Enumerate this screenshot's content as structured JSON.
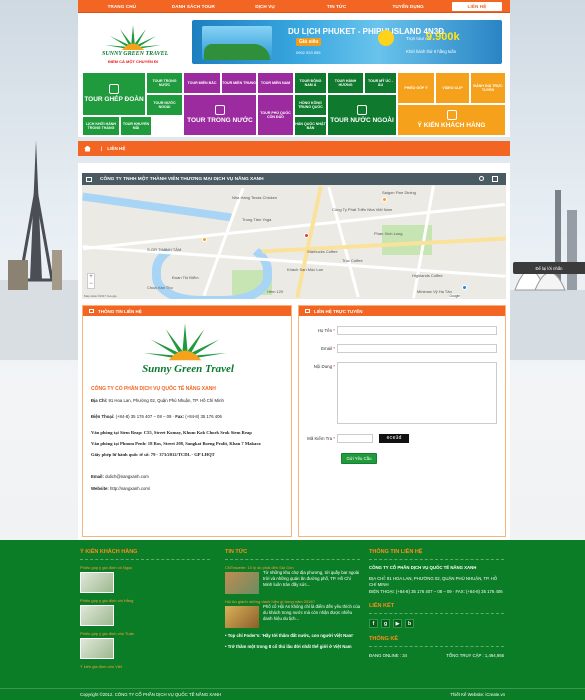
{
  "nav": {
    "items": [
      "TRANG CHỦ",
      "DANH SÁCH TOUR",
      "DỊCH VỤ",
      "TIN TỨC",
      "TUYỂN DỤNG",
      "LIÊN HỆ"
    ]
  },
  "logo": {
    "brand": "SUNNY GREEN TRAVEL",
    "slogan": "ĐIỂM CÀ MỘT CHUYẾN ĐI"
  },
  "banner": {
    "title": "DU LỊCH PHUKET - PHIPHI ISLAND 4N3Đ",
    "badge": "Giá siêu",
    "from": "Trọn tour chỉ",
    "price": "9.900k",
    "sub": "Khởi hành thứ 6 hằng tuần",
    "phone": "0902 533 599"
  },
  "mega": {
    "tour_ghep_doan": "TOUR GHÉP ĐOÀN",
    "tour_trong_nuoc_s": "TOUR TRONG NƯỚC",
    "tour_mien_bac": "TOUR MIỀN BẮC",
    "tour_mien_trung": "TOUR MIỀN TRUNG",
    "tour_mien_nam": "TOUR MIỀN NAM",
    "tour_dong_nam_a": "TOUR ĐÔNG NAM Á",
    "tour_hanh_huong": "TOUR HÀNH HƯƠNG",
    "tour_my_uc_au": "TOUR MỸ ÚC - ÂU",
    "phieu_gop_y": "PHIẾU GÓP Ý",
    "video_clip": "VIDEO CLIP",
    "danh_gia": "ĐÁNH GIÁ TRỰC TUYẾN",
    "lich_khoi_hanh": "LỊCH KHỞI HÀNH TRONG THÁNG",
    "tour_nuoc_ngoai_s": "TOUR NƯỚC NGOÀI",
    "tour_trong_nuoc_b": "TOUR TRONG NƯỚC",
    "phu_quoc": "TOUR PHÚ QUỐC CÔN ĐẢO",
    "tour_nuoc_ngoai_b": "TOUR NƯỚC NGOÀI",
    "hong_kong": "HỒNG KÔNG TRUNG QUỐC",
    "han_quoc": "HÀN QUỐC NHẬT BẢN",
    "tour_khuyen_mai": "TOUR KHUYẾN MÃI",
    "y_kien": "Ý KIẾN KHÁCH HÀNG"
  },
  "breadcrumb": {
    "current": "LIÊN HỆ"
  },
  "map": {
    "title": "CÔNG TY TNHH MỘT THÀNH VIÊN THƯƠNG MẠI DỊCH VỤ NẮNG XANH",
    "labels": [
      "Nha Hàng Texas Chicken",
      "Công Ty Phát Triển Nhà Việt Nam",
      "Starbucks Coffee",
      "Phan Xích Long",
      "Khách Sạn Mộc Lan",
      "Saigon Fine Dining",
      "S-GR THANH TÂM",
      "Trung Tâm Yoga",
      "Highlands Coffee",
      "Trúc Coffee",
      "Minimax Vỹ Hạ Tân",
      "Đoàn Thị Điểm",
      "Chùa Vạn Thọ",
      "Hẻm 120"
    ],
    "attribution": "Map data ©2017 Google",
    "google": "Google"
  },
  "info": {
    "header": "THÔNG TIN LIÊN HỆ",
    "logo_text": "Sunny Green Travel",
    "company": "CÔNG TY TNHH MỘT THÀNH VIÊN THƯƠNG MẠI DỊCH VỤ NẮNG XANH",
    "company_short": "CÔNG TY CỔ PHẦN DỊCH VỤ QUỐC TẾ NẮNG XANH",
    "address_label": "Địa Chỉ:",
    "address": "91 Hoa Lan, Phường 02, Quận Phú Nhuận, TP. Hồ Chí Minh",
    "phone_label": "Điện Thoại:",
    "phone": "(+84-8) 35 176 407 – 08 – 09",
    "fax_label": "Fax:",
    "fax": "(+84-8) 35 176 406",
    "siem_reap": "Văn phòng tại Siem Reap: C55, Street Komay, Khum Kok Chork Srok Siem Reap",
    "phnom_penh": "Văn phòng tại Phnom Penh: 18 Ros, Street 208, Sangkat Boeng Prolit, Khan 7 Makara",
    "license": "Giấy phép lữ hành quốc tế số: 79 - 373/2012/TCDL - GP LHQT",
    "email_label": "Email:",
    "email": "dulich@nangxanh.com",
    "website_label": "Website:",
    "website": "http://nangxanh.com/"
  },
  "form": {
    "header": "LIÊN HỆ TRỰC TUYẾN",
    "name_label": "Họ Tên",
    "email_label": "Email",
    "content_label": "Nội Dung",
    "captcha_label": "Mã Kiểm Tra",
    "captcha": "ece3d",
    "submit": "Gửi Yêu Cầu"
  },
  "side": {
    "contact": "Để lại lời nhắn"
  },
  "footer": {
    "reviews": {
      "title": "Ý KIẾN KHÁCH HÀNG",
      "items": [
        "Phiếu góp ý gia đình cô Ngọc",
        "Phiếu góp ý gia đình chị Hằng",
        "Phiếu góp ý gia đình chú Tuấn",
        "Ý kiến gia đình chú Việt"
      ]
    },
    "news": {
      "title": "TIN TỨC",
      "items": [
        {
          "title": "CNTraveler: 10 lý do phải đến Sài Gòn",
          "text": "Từ những khu chợ địa phương, tới quầy bar ngoài trời và những quán ăn đường phố, TP. Hồ Chí Minh luôn tràn đầy sức..."
        },
        {
          "title": "Hội An giành những danh hiệu gì trong năm 2016?",
          "text": "Phố cổ Hội An không chỉ là điểm đến yêu thích của du khách trong nước mà còn nhận được nhiều danh hiệu du lịch..."
        }
      ],
      "links": [
        "Top chỉ Foder's: 'Hãy tới thăm đất nước, con người Việt Nam'",
        "Trở thăm một trong 8 cổ thú lâu đời nhất thế giới ở Việt Nam"
      ]
    },
    "contact": {
      "title": "THÔNG TIN LIÊN HỆ",
      "company": "CÔNG TY CỔ PHẦN DỊCH VỤ QUỐC TẾ NẮNG XANH",
      "address": "ĐỊA CHỈ: 91 HOA LAN, PHƯỜNG 02, QUẬN PHÚ NHUẬN, TP. HỒ CHÍ MINH",
      "phone": "ĐIỆN THOẠI: (+84-8) 35 176 407 – 08 – 09 · FAX: (+84-8) 35 176 406",
      "links_title": "LIÊN KẾT",
      "stats_title": "THỐNG KÊ",
      "online_label": "ĐANG ONLINE : 34",
      "total_label": "TỔNG TRUY CẬP : 1,494,955"
    },
    "copyright": "Copyright ©2012. CÔNG TY CỔ PHẦN DỊCH VỤ QUỐC TẾ NẮNG XANH",
    "designer": "Thiết Kế Website: iCreate.vn"
  },
  "colors": {
    "orange": "#f26522",
    "green": "#1f9a3d",
    "purple": "#9b2b9e",
    "yellow": "#f5a11c",
    "footer": "#0b7d27"
  }
}
